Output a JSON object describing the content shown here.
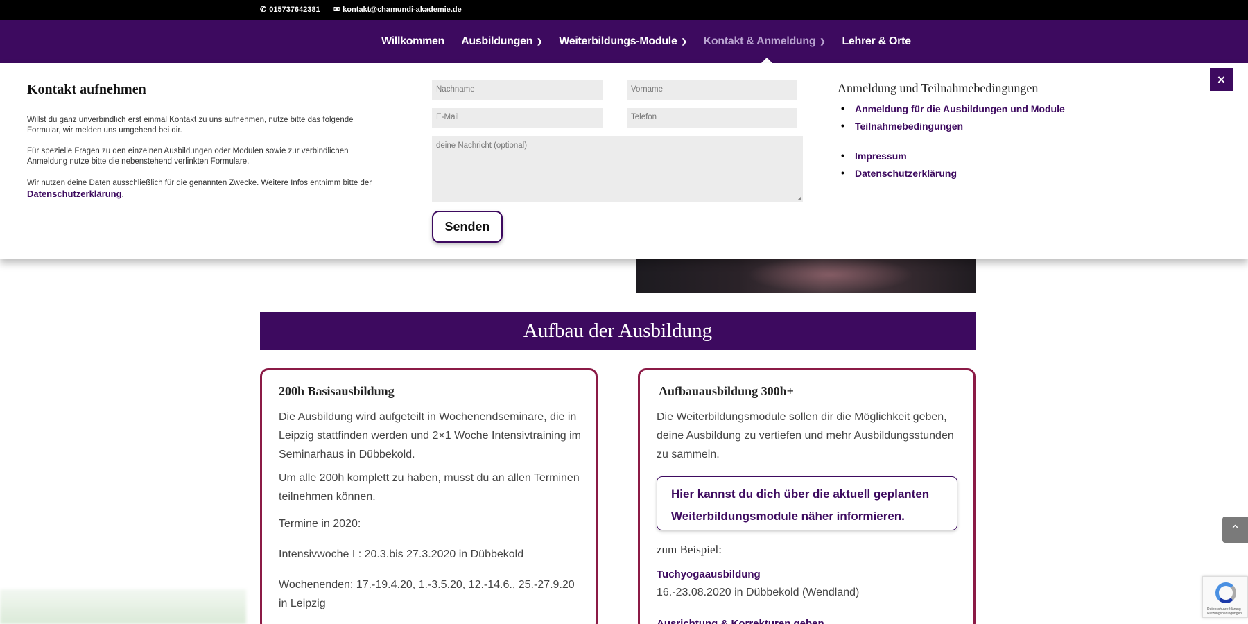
{
  "topbar": {
    "phone": "015737642381",
    "email": "kontakt@chamundi-akademie.de"
  },
  "nav": {
    "items": [
      {
        "label": "Willkommen",
        "dropdown": false
      },
      {
        "label": "Ausbildungen",
        "dropdown": true
      },
      {
        "label": "Weiterbildungs-Module",
        "dropdown": true
      },
      {
        "label": "Kontakt & Anmeldung",
        "dropdown": true,
        "active": true
      },
      {
        "label": "Lehrer & Orte",
        "dropdown": false
      }
    ]
  },
  "contact_panel": {
    "title": "Kontakt aufnehmen",
    "para1": "Willst du ganz unverbindlich erst einmal Kontakt zu uns aufnehmen, nutze bitte das folgende Formular, wir melden uns umgehend bei dir.",
    "para2": "Für spezielle Fragen zu den einzelnen Ausbildungen oder Modulen sowie zur verbindlichen Anmeldung nutze bitte die nebenstehend verlinkten Formulare.",
    "para3_prefix": "Wir nutzen deine Daten ausschließlich für die genannten Zwecke. Weitere Infos entnimm bitte der ",
    "para3_link": "Datenschutzerklärung",
    "para3_suffix": ".",
    "form": {
      "lastname_placeholder": "Nachname",
      "firstname_placeholder": "Vorname",
      "email_placeholder": "E-Mail",
      "phone_placeholder": "Telefon",
      "message_placeholder": "deine Nachricht (optional)",
      "submit_label": "Senden"
    },
    "right_title": "Anmeldung und Teilnahmebedingungen",
    "links_group1": [
      "Anmeldung für die Ausbildungen und Module",
      "Teilnahmebedingungen"
    ],
    "links_group2": [
      "Impressum",
      "Datenschutzerklärung"
    ],
    "close_label": "×"
  },
  "section": {
    "band_title": "Aufbau der Ausbildung"
  },
  "card_left": {
    "title": "200h Basisausbildung",
    "p1": "Die Ausbildung wird aufgeteilt in Wochenendseminare, die in Leipzig stattfinden werden und 2×1 Woche Intensivtraining im Seminarhaus in Dübbekold.",
    "p2": "Um alle 200h komplett zu haben, musst du an allen Terminen teilnehmen können.",
    "p3": "Termine in 2020:",
    "p4": "Intensivwoche I : 20.3.bis 27.3.2020 in Dübbekold",
    "p5": "Wochenenden: 17.-19.4.20, 1.-3.5.20, 12.-14.6., 25.-27.9.20 in Leipzig"
  },
  "card_right": {
    "title": "Aufbauausbildung 300h+",
    "p1": "Die Weiterbildungsmodule sollen dir die Möglichkeit geben, deine Ausbildung zu vertiefen und mehr Ausbildungsstunden zu sammeln.",
    "info_box": "Hier kannst du dich über die aktuell geplanten Weiterbildungsmodule näher informieren.",
    "example_label": "zum Beispiel:",
    "module1_title": "Tuchyogaausbildung",
    "module1_date": "16.-23.08.2020 in Dübbekold (Wendland)",
    "module2_title": "Ausrichtung & Korrekturen geben"
  },
  "widgets": {
    "to_top_icon": "chevron-up-icon",
    "recaptcha_text": "Datenschutzerklärung · Nutzungsbedingungen"
  },
  "colors": {
    "brand_purple": "#3d0a5f",
    "card_border": "#8b1a46",
    "topbar": "#000000"
  }
}
